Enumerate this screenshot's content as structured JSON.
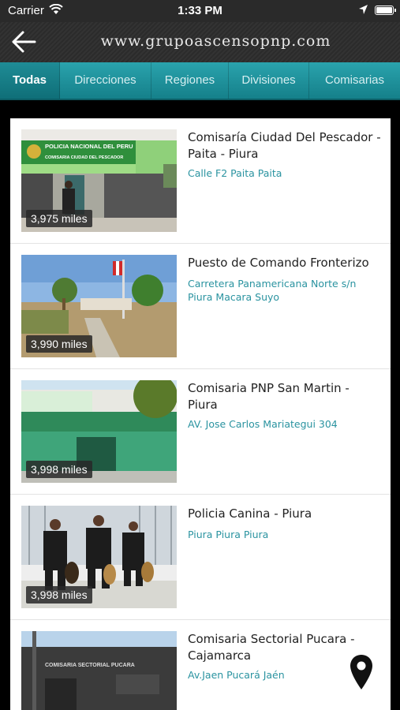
{
  "status": {
    "carrier": "Carrier",
    "time": "1:33 PM"
  },
  "header": {
    "title": "www.grupoascensopnp.com"
  },
  "tabs": [
    "Todas",
    "Direcciones",
    "Regiones",
    "Divisiones",
    "Comisarias"
  ],
  "items": [
    {
      "name": "Comisaría Ciudad Del Pescador - Paita - Piura",
      "address": "Calle F2 Paita Paita",
      "distance": "3,975 miles",
      "sign_text": "POLICIA NACIONAL DEL PERU",
      "sign_sub": "COMISARIA CIUDAD DEL PESCADOR"
    },
    {
      "name": "Puesto de Comando Fronterizo",
      "address": "Carretera Panamericana Norte s/n Piura Macara Suyo",
      "distance": "3,990 miles"
    },
    {
      "name": "Comisaria PNP San Martin - Piura",
      "address": "AV. Jose Carlos Mariategui 304",
      "distance": "3,998 miles"
    },
    {
      "name": "Policia Canina - Piura",
      "address": "Piura Piura Piura",
      "distance": "3,998 miles"
    },
    {
      "name": "Comisaria Sectorial Pucara - Cajamarca",
      "address": "Av.Jaen Pucará Jaén",
      "distance": "",
      "sign_text": "COMISARIA SECTORIAL PUCARA"
    }
  ],
  "icons": {
    "back": "back-arrow-icon",
    "map": "map-pin-icon",
    "wifi": "wifi-icon",
    "location": "location-arrow-icon",
    "battery": "battery-icon"
  },
  "colors": {
    "accent": "#1e939d",
    "link": "#2a93a0"
  }
}
